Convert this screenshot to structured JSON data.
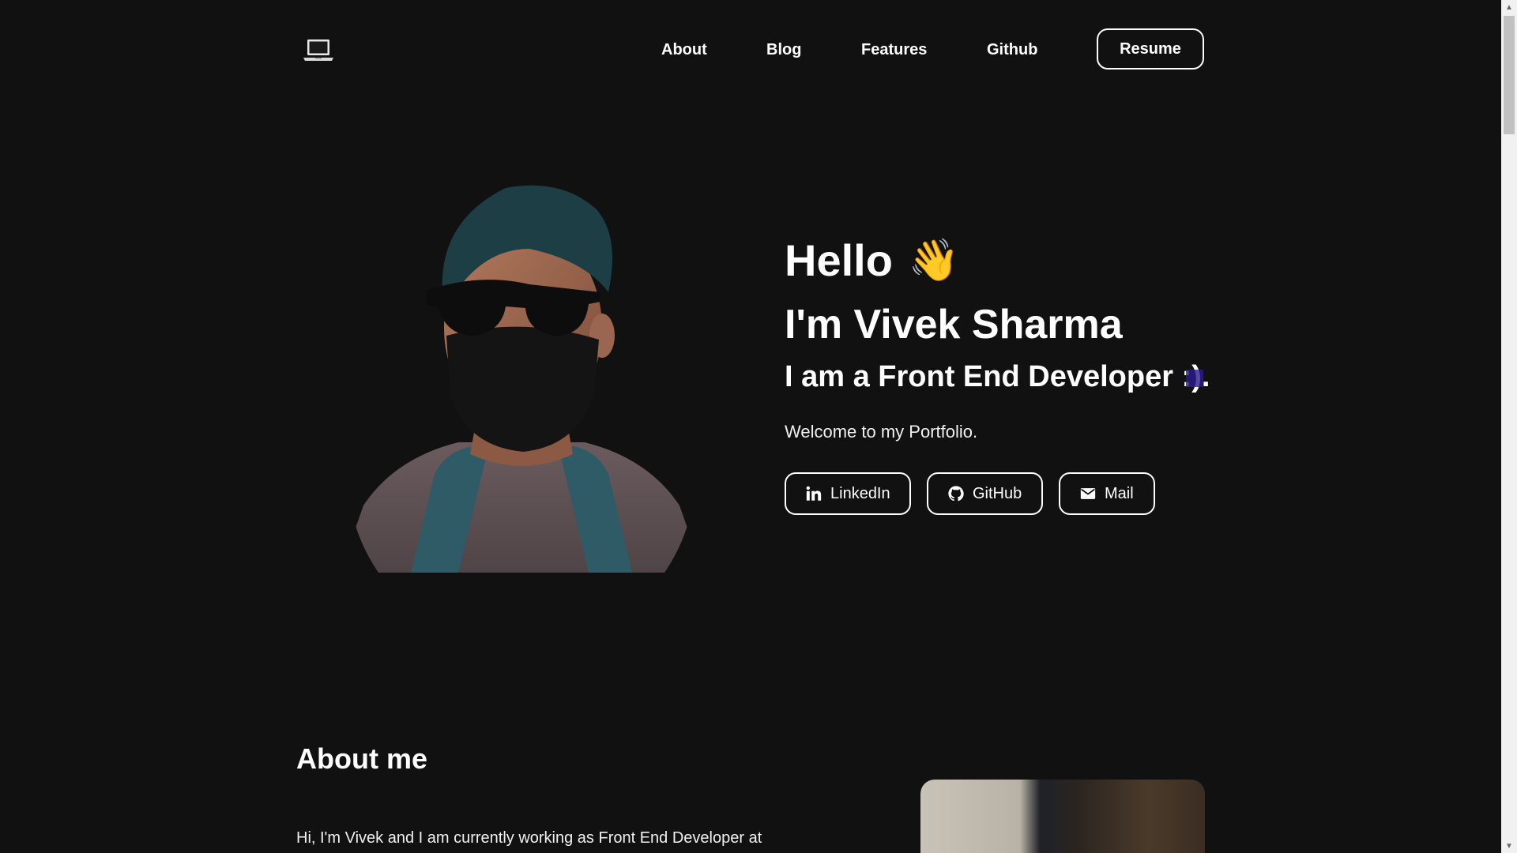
{
  "header": {
    "logo_icon": "laptop-icon",
    "nav": [
      {
        "label": "About"
      },
      {
        "label": "Blog"
      },
      {
        "label": "Features"
      },
      {
        "label": "Github"
      }
    ],
    "resume_label": "Resume"
  },
  "hero": {
    "greeting": "Hello",
    "wave_emoji": "👋",
    "name": "I'm Vivek Sharma",
    "role": "I am a Front End Developer :).",
    "welcome": "Welcome to my Portfolio.",
    "social": {
      "linkedin_label": "LinkedIn",
      "linkedin_icon": "linkedin-icon",
      "github_label": "GitHub",
      "github_icon": "github-icon",
      "mail_label": "Mail",
      "mail_icon": "mail-icon"
    }
  },
  "about": {
    "title": "About me",
    "text": "Hi, I'm Vivek and I am currently working as Front End Developer at"
  },
  "colors": {
    "background": "#111111",
    "text": "#ffffff",
    "accent_cursor": "#2a1b8c"
  }
}
